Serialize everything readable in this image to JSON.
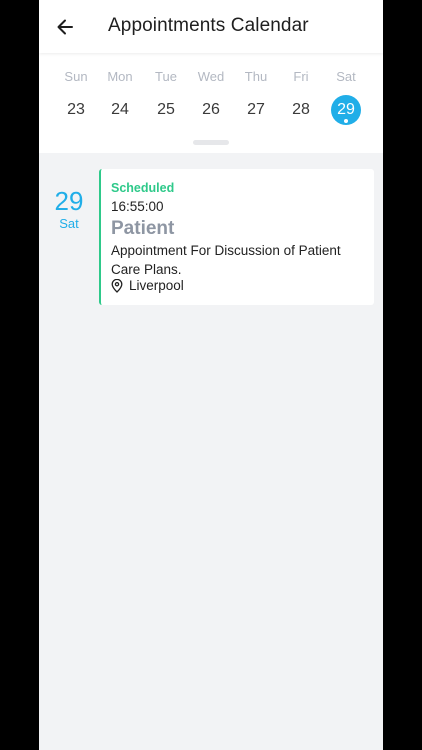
{
  "header": {
    "title": "Appointments Calendar",
    "back_icon": "arrow-left-icon"
  },
  "week": {
    "days": [
      {
        "dow": "Sun",
        "num": "23"
      },
      {
        "dow": "Mon",
        "num": "24"
      },
      {
        "dow": "Tue",
        "num": "25"
      },
      {
        "dow": "Wed",
        "num": "26"
      },
      {
        "dow": "Thu",
        "num": "27"
      },
      {
        "dow": "Fri",
        "num": "28"
      },
      {
        "dow": "Sat",
        "num": "29"
      }
    ],
    "selected_num": "29",
    "accent_color": "#21aee8"
  },
  "appointment": {
    "date_num": "29",
    "date_dow": "Sat",
    "status": "Scheduled",
    "status_color": "#2ec98a",
    "time": "16:55:00",
    "type": "Patient",
    "description": "Appointment For Discussion of Patient Care Plans.",
    "location": "Liverpool",
    "location_icon": "map-pin-icon"
  }
}
